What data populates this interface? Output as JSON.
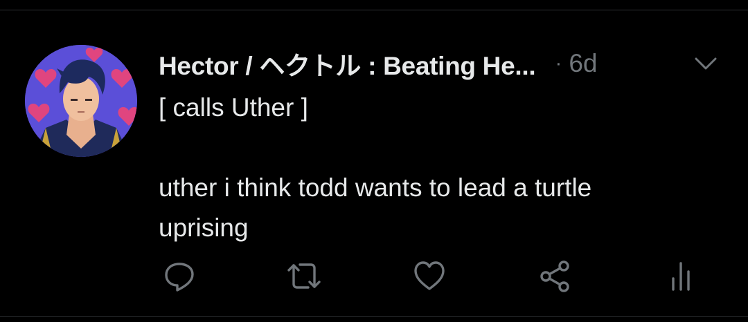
{
  "tweet": {
    "display_name": "Hector / ヘクトル : Beating He...",
    "meta_dot": "·",
    "timestamp": "6d",
    "text_lines": [
      "[ calls Uther ]",
      "",
      "uther i think todd wants to lead a turtle",
      "uprising"
    ]
  },
  "actions": [
    {
      "name": "reply",
      "icon": "reply-icon"
    },
    {
      "name": "retweet",
      "icon": "retweet-icon"
    },
    {
      "name": "like",
      "icon": "heart-icon"
    },
    {
      "name": "share",
      "icon": "share-icon"
    },
    {
      "name": "analytics",
      "icon": "analytics-icon"
    }
  ],
  "colors": {
    "background": "#000000",
    "text": "#e7e9ea",
    "secondary": "#71767b",
    "divider": "#2f3336"
  }
}
